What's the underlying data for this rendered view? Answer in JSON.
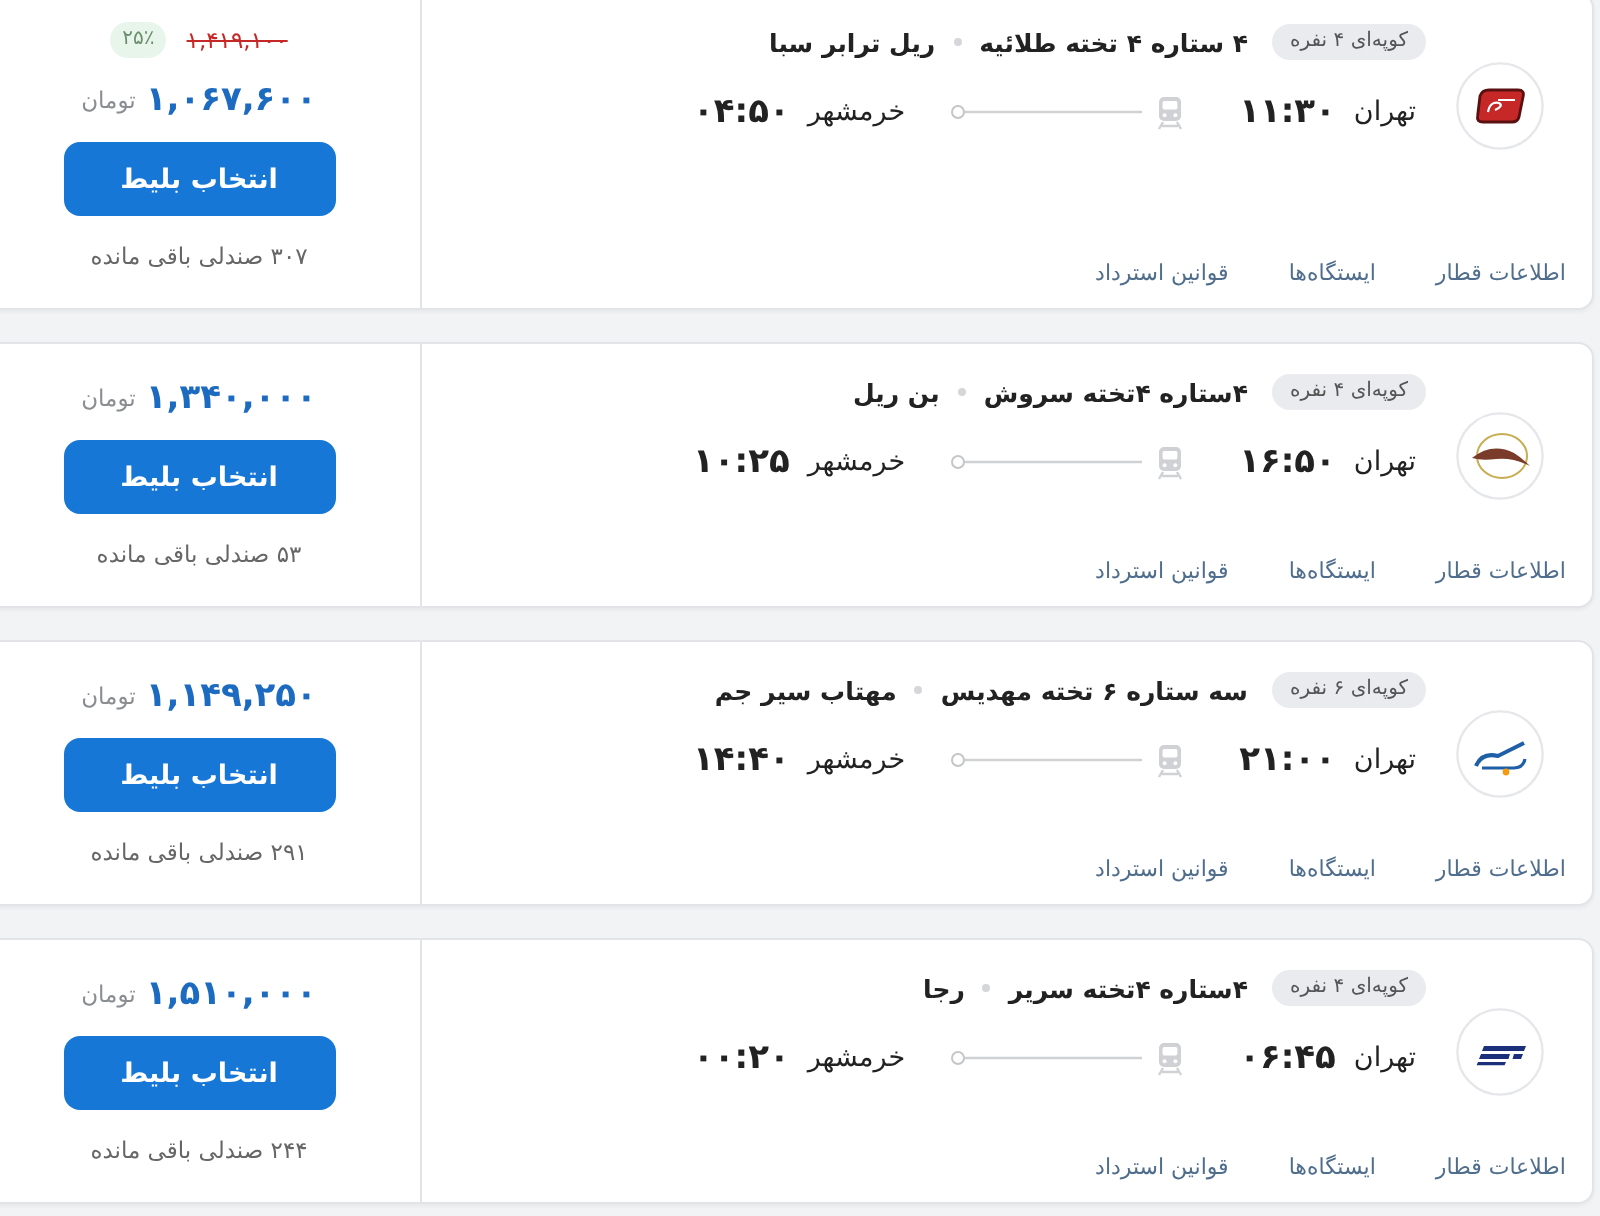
{
  "tickets": [
    {
      "compartment": "کوپه‌ای ۴ نفره",
      "train_name": "۴ ستاره ۴ تخته طلائیه",
      "company": "ریل ترابر سبا",
      "departure": {
        "city": "تهران",
        "time": "۱۱:۳۰"
      },
      "arrival": {
        "city": "خرمشهر",
        "time": "۰۴:۵۰"
      },
      "links": [
        "اطلاعات قطار",
        "ایستگاه‌ها",
        "قوانین استرداد"
      ],
      "old_price": "۱,۴۱۹,۱۰۰",
      "discount": "۲۵٪",
      "price": "۱,۰۶۷,۶۰۰",
      "currency": "تومان",
      "button": "انتخاب بلیط",
      "seats": "۳۰۷ صندلی باقی مانده"
    },
    {
      "compartment": "کوپه‌ای ۴ نفره",
      "train_name": "۴ستاره ۴تخته سروش",
      "company": "بن ریل",
      "departure": {
        "city": "تهران",
        "time": "۱۶:۵۰"
      },
      "arrival": {
        "city": "خرمشهر",
        "time": "۱۰:۲۵"
      },
      "links": [
        "اطلاعات قطار",
        "ایستگاه‌ها",
        "قوانین استرداد"
      ],
      "price": "۱,۳۴۰,۰۰۰",
      "currency": "تومان",
      "button": "انتخاب بلیط",
      "seats": "۵۳ صندلی باقی مانده"
    },
    {
      "compartment": "کوپه‌ای ۶ نفره",
      "train_name": "سه ستاره ۶ تخته مهدیس",
      "company": "مهتاب سیر جم",
      "departure": {
        "city": "تهران",
        "time": "۲۱:۰۰"
      },
      "arrival": {
        "city": "خرمشهر",
        "time": "۱۴:۴۰"
      },
      "links": [
        "اطلاعات قطار",
        "ایستگاه‌ها",
        "قوانین استرداد"
      ],
      "price": "۱,۱۴۹,۲۵۰",
      "currency": "تومان",
      "button": "انتخاب بلیط",
      "seats": "۲۹۱ صندلی باقی مانده"
    },
    {
      "compartment": "کوپه‌ای ۴ نفره",
      "train_name": "۴ستاره ۴تخته سریر",
      "company": "رجا",
      "departure": {
        "city": "تهران",
        "time": "۰۶:۴۵"
      },
      "arrival": {
        "city": "خرمشهر",
        "time": "۰۰:۲۰"
      },
      "links": [
        "اطلاعات قطار",
        "ایستگاه‌ها",
        "قوانین استرداد"
      ],
      "price": "۱,۵۱۰,۰۰۰",
      "currency": "تومان",
      "button": "انتخاب بلیط",
      "seats": "۲۴۴ صندلی باقی مانده"
    }
  ]
}
